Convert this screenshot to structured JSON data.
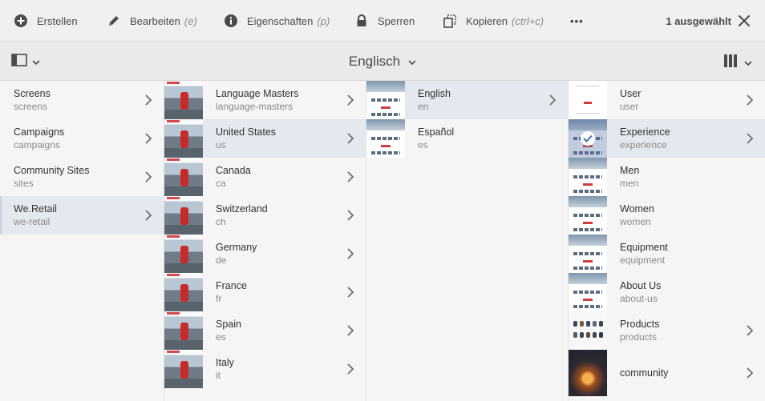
{
  "actionbar": {
    "create": "Erstellen",
    "edit": "Bearbeiten",
    "edit_hint": "(e)",
    "properties": "Eigenschaften",
    "properties_hint": "(p)",
    "lock": "Sperren",
    "copy": "Kopieren",
    "copy_hint": "(ctrl+c)",
    "more": "•••",
    "selected": "1 ausgewählt"
  },
  "titlebar": {
    "title": "Englisch"
  },
  "columns": [
    {
      "items": [
        {
          "name": "Screens",
          "sub": "screens"
        },
        {
          "name": "Campaigns",
          "sub": "campaigns"
        },
        {
          "name": "Community Sites",
          "sub": "sites"
        },
        {
          "name": "We.Retail",
          "sub": "we-retail"
        }
      ]
    },
    {
      "items": [
        {
          "name": "Language Masters",
          "sub": "language-masters"
        },
        {
          "name": "United States",
          "sub": "us"
        },
        {
          "name": "Canada",
          "sub": "ca"
        },
        {
          "name": "Switzerland",
          "sub": "ch"
        },
        {
          "name": "Germany",
          "sub": "de"
        },
        {
          "name": "France",
          "sub": "fr"
        },
        {
          "name": "Spain",
          "sub": "es"
        },
        {
          "name": "Italy",
          "sub": "it"
        }
      ]
    },
    {
      "items": [
        {
          "name": "English",
          "sub": "en"
        },
        {
          "name": "Español",
          "sub": "es"
        }
      ]
    },
    {
      "items": [
        {
          "name": "User",
          "sub": "user"
        },
        {
          "name": "Experience",
          "sub": "experience"
        },
        {
          "name": "Men",
          "sub": "men"
        },
        {
          "name": "Women",
          "sub": "women"
        },
        {
          "name": "Equipment",
          "sub": "equipment"
        },
        {
          "name": "About Us",
          "sub": "about-us"
        },
        {
          "name": "Products",
          "sub": "products"
        },
        {
          "name": "community",
          "sub": ""
        }
      ]
    }
  ],
  "icons": {
    "create": "add-circle-icon",
    "edit": "pencil-icon",
    "properties": "info-circle-icon",
    "lock": "lock-icon",
    "copy": "copy-icon",
    "more": "more-icon",
    "close": "close-icon",
    "rail": "rail-toggle-icon",
    "view": "column-view-icon",
    "chevron": "chevron-down-icon",
    "arrow": "chevron-right-icon",
    "check": "checkmark-icon"
  },
  "colors": {
    "active_row": "#e4e8ef",
    "accent_red": "#d23b3b",
    "text": "#323232",
    "subtext": "#8a8a8a"
  }
}
